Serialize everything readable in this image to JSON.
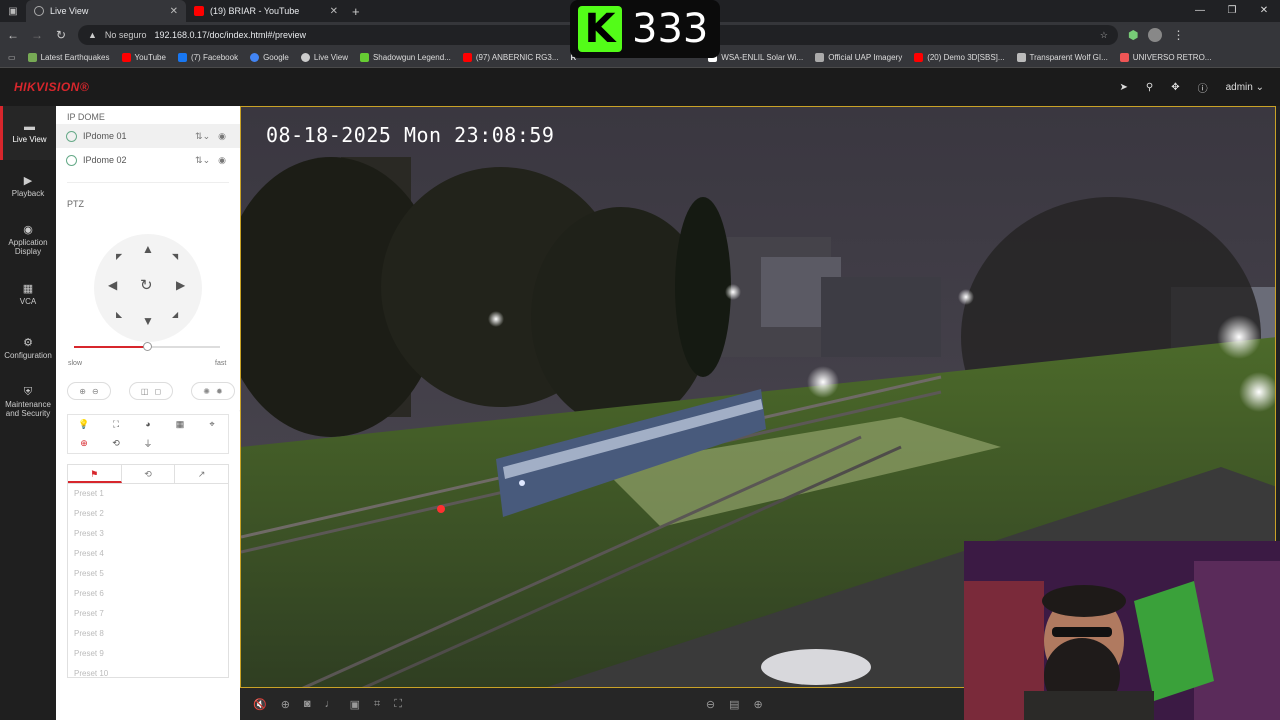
{
  "browser": {
    "tabs": [
      {
        "label": "Live View",
        "active": true
      },
      {
        "label": "(19) BRIAR - YouTube",
        "active": false
      }
    ],
    "address": {
      "security": "No seguro",
      "url": "192.168.0.17/doc/index.html#/preview"
    },
    "bookmarks": [
      "Latest Earthquakes",
      "YouTube",
      "(7) Facebook",
      "Google",
      "Live View",
      "Shadowgun Legend...",
      "(97) ANBERNIC RG3...",
      "R",
      "WSA-ENLIL Solar Wi...",
      "Official UAP Imagery",
      "(20) Demo 3D[SBS]...",
      "Transparent Wolf GI...",
      "UNIVERSO RETRO..."
    ]
  },
  "overlay": {
    "kick_number": "333"
  },
  "app": {
    "brand": "HIKVISION®",
    "user": "admin",
    "nav": [
      {
        "label": "Live View",
        "icon": "live-view-icon"
      },
      {
        "label": "Playback",
        "icon": "playback-icon"
      },
      {
        "label": "Application Display",
        "icon": "application-icon"
      },
      {
        "label": "VCA",
        "icon": "vca-icon"
      },
      {
        "label": "Configuration",
        "icon": "gear-icon"
      },
      {
        "label": "Maintenance and Security",
        "icon": "maintenance-icon"
      }
    ],
    "panel": {
      "group_title": "IP DOME",
      "cameras": [
        "IPdome 01",
        "IPdome 02"
      ],
      "ptz_title": "PTZ",
      "speed": {
        "min_label": "slow",
        "max_label": "fast",
        "level": 0.5
      },
      "presets": [
        "Preset 1",
        "Preset 2",
        "Preset 3",
        "Preset 4",
        "Preset 5",
        "Preset 6",
        "Preset 7",
        "Preset 8",
        "Preset 9",
        "Preset 10"
      ]
    },
    "video": {
      "osd_timestamp": "08-18-2025 Mon 23:08:59"
    }
  },
  "colors": {
    "brand_red": "#d7262c",
    "frame_gold": "#c9a227",
    "kick_green": "#53fc18"
  }
}
